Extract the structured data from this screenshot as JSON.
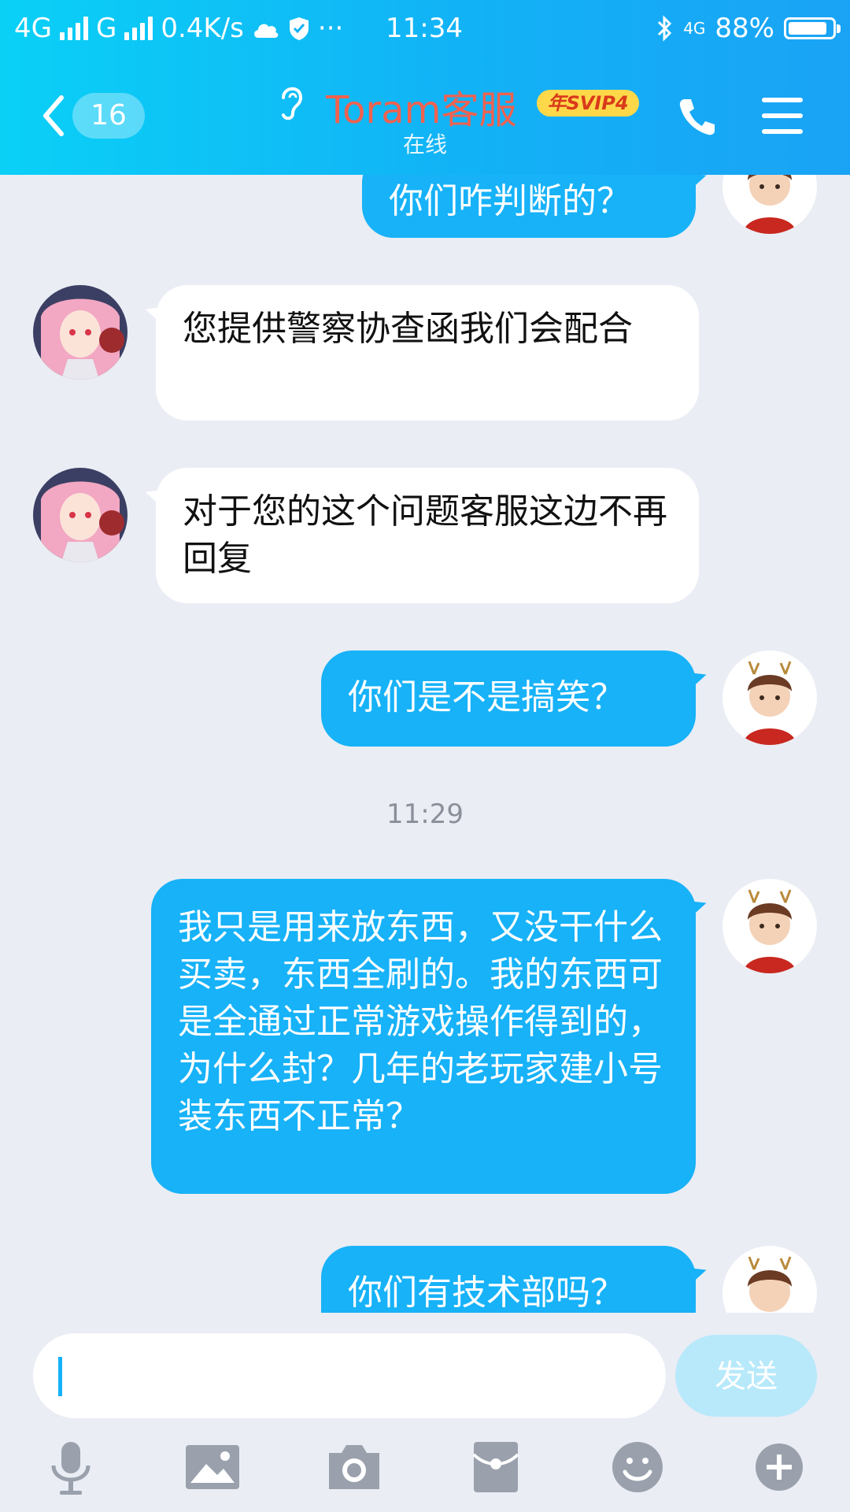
{
  "status_bar": {
    "network_left": "4G",
    "network_mid": "G",
    "speed": "0.4K/s",
    "time": "11:34",
    "network_right": "4G",
    "battery": "88%",
    "battery_level": 0.88
  },
  "header": {
    "unread_count": "16",
    "title": "Toram客服",
    "vip_badge": "年SVIP4",
    "subtitle": "在线"
  },
  "messages": [
    {
      "from": "me",
      "text": "你们咋判断的？"
    },
    {
      "from": "them",
      "text": "您提供警察协查函我们会配合"
    },
    {
      "from": "them",
      "text": "对于您的这个问题客服这边不再回复"
    },
    {
      "from": "me",
      "text": "你们是不是搞笑？"
    },
    {
      "from": "time",
      "text": "11:29"
    },
    {
      "from": "me",
      "text": "我只是用来放东西，又没干什么买卖，东西全刷的。我的东西可是全通过正常游戏操作得到的，为什么封？几年的老玩家建小号装东西不正常？"
    },
    {
      "from": "me",
      "text": "你们有技术部吗？"
    }
  ],
  "input": {
    "value": "",
    "send_label": "发送"
  },
  "toolbar": {
    "icons": [
      "microphone-icon",
      "image-icon",
      "camera-icon",
      "red-packet-icon",
      "emoji-icon",
      "plus-icon"
    ]
  },
  "colors": {
    "header_start": "#0ad0f6",
    "header_end": "#1aa3f5",
    "my_bubble": "#17b2f8",
    "their_bubble": "#ffffff",
    "title_color": "#f0614f",
    "background": "#eaedf4"
  }
}
